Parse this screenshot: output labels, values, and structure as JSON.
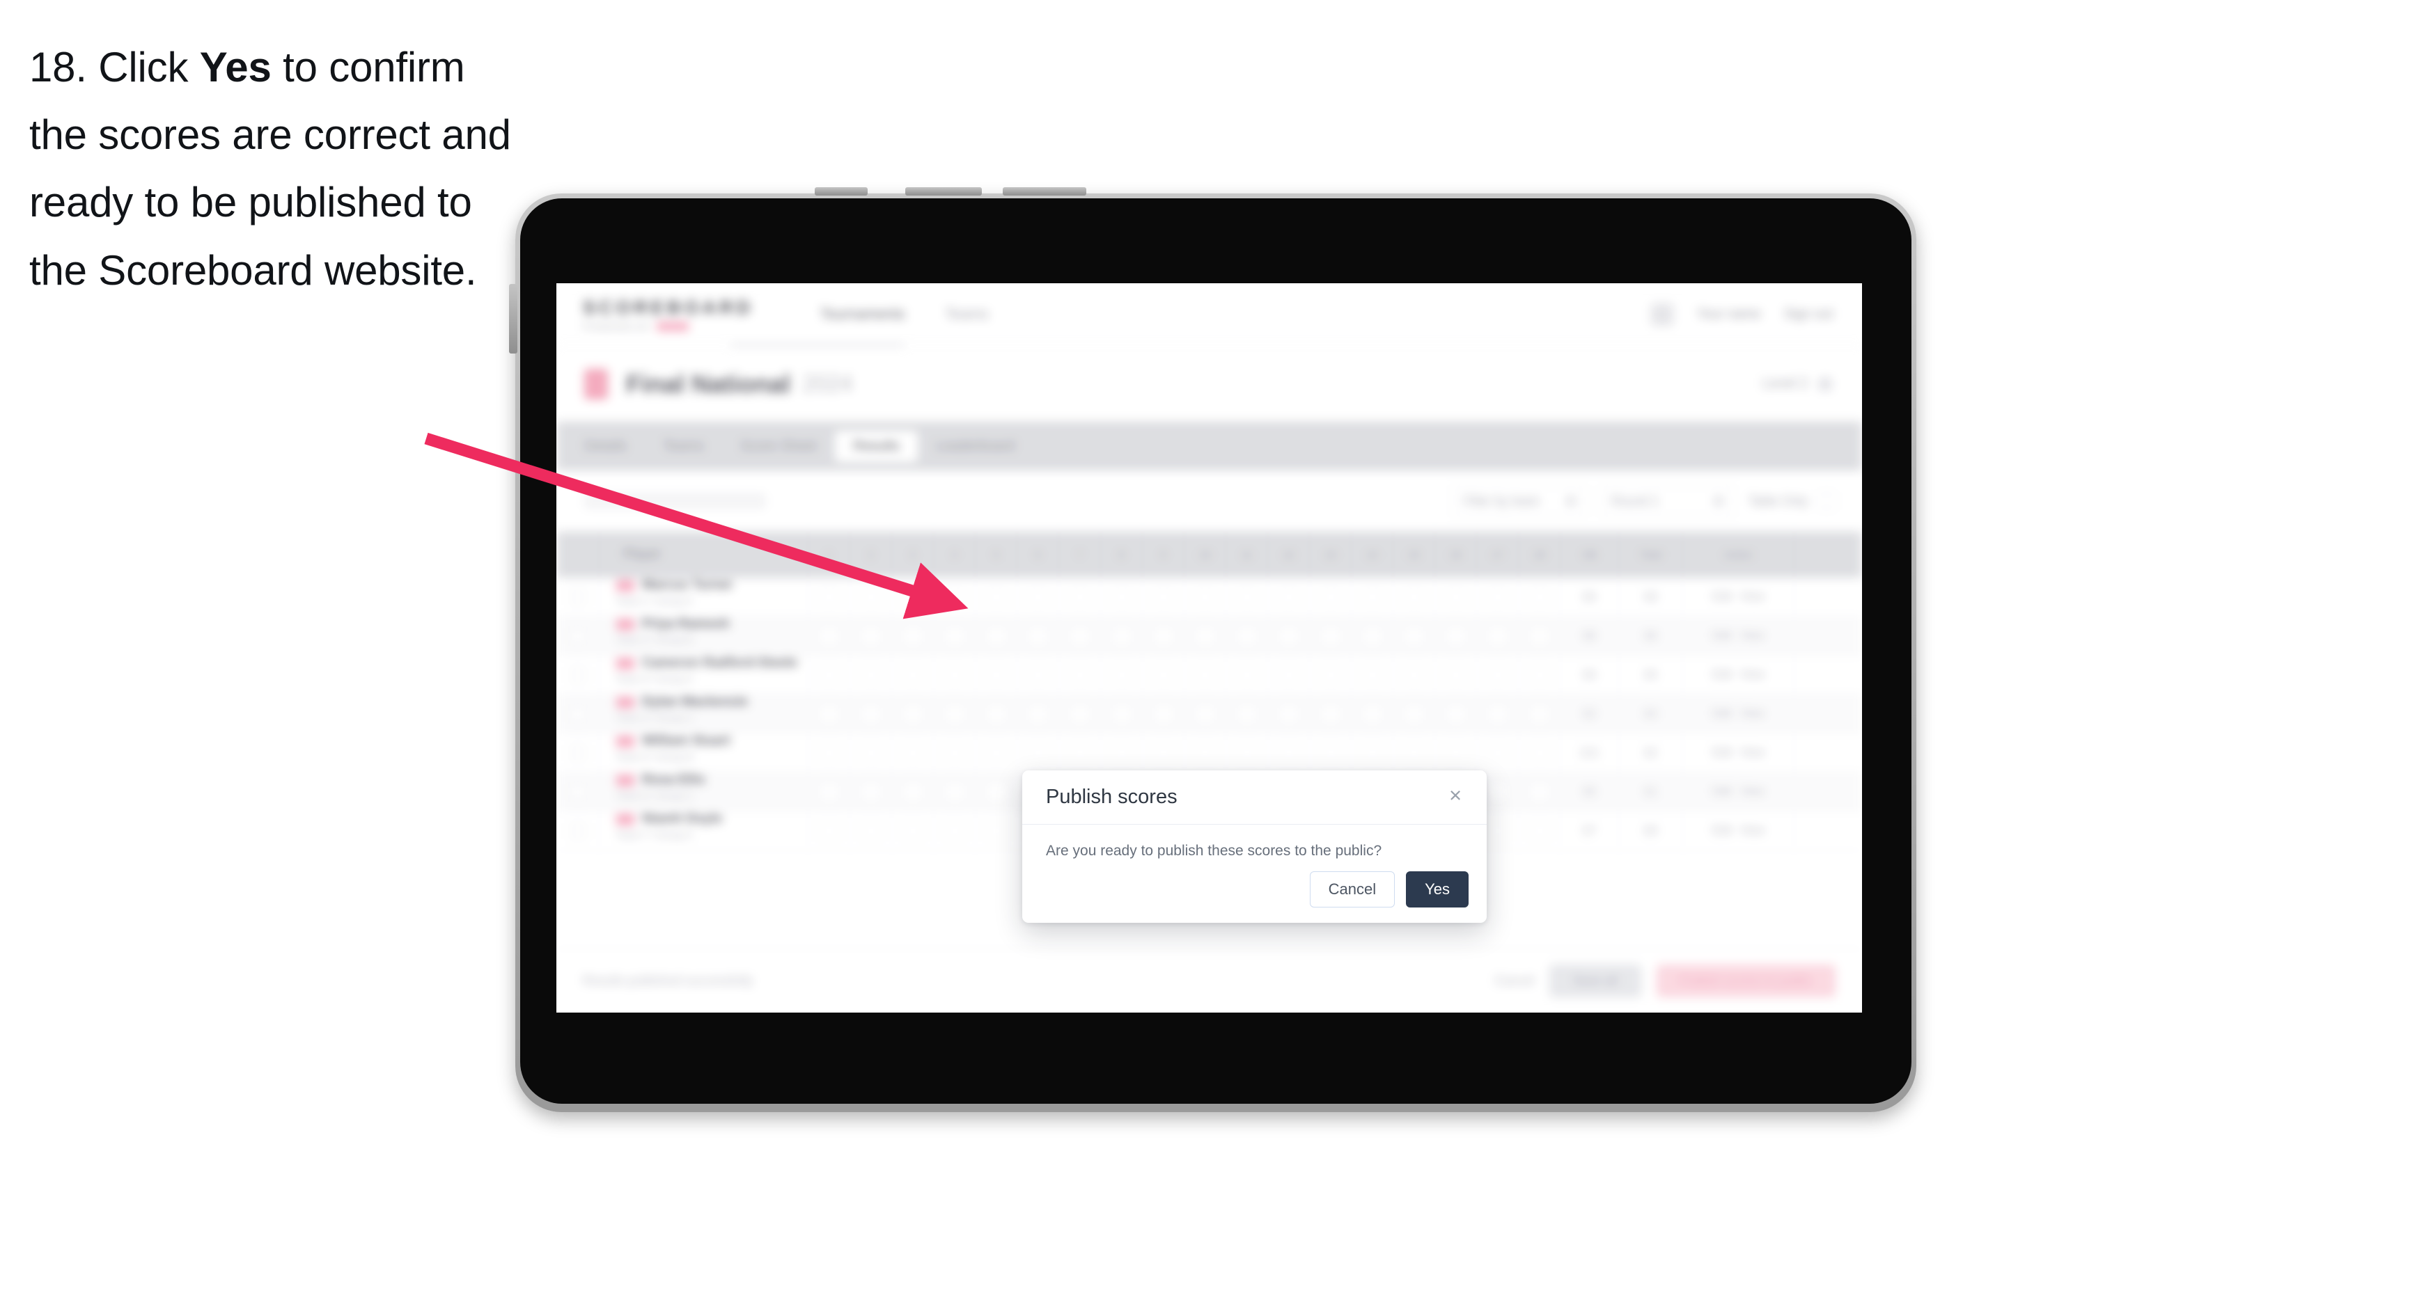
{
  "caption": {
    "number": "18.",
    "pre": "Click",
    "bold": "Yes",
    "post": "to confirm the scores are correct and ready to be published to the Scoreboard website."
  },
  "colors": {
    "arrow": "#ee2b5e",
    "primary_button": "#2c3a4f",
    "cancel_border": "#cfdcf0",
    "brand_accent": "#f7a8be",
    "tab_bar": "#d7d8dc"
  },
  "modal": {
    "title": "Publish scores",
    "message": "Are you ready to publish these scores to the public?",
    "close_icon": "×",
    "cancel_label": "Cancel",
    "confirm_label": "Yes"
  },
  "app": {
    "brand": {
      "word": "SCOREBOARD",
      "sub": "POWERED BY"
    },
    "top_nav": [
      "Tournaments",
      "Teams"
    ],
    "header_right": [
      "Your name",
      "Sign out"
    ],
    "title_bar": {
      "flag": "flag-icon",
      "competition": "Final National",
      "year": "2024",
      "right_label": "Level 2"
    },
    "tabs": [
      {
        "label": "Details",
        "selected": false
      },
      {
        "label": "Teams",
        "selected": false
      },
      {
        "label": "Score Sheet",
        "selected": false
      },
      {
        "label": "Results",
        "selected": true
      },
      {
        "label": "Leaderboard",
        "selected": false
      }
    ],
    "filters": {
      "search_placeholder": "Search",
      "filter_one": "Filter by team",
      "filter_two": "Round 1",
      "filter_three": "Table Only"
    },
    "table": {
      "columns": [
        "",
        "Player",
        "1",
        "2",
        "3",
        "4",
        "5",
        "6",
        "7",
        "8",
        "9",
        "10",
        "11",
        "12",
        "13",
        "14",
        "15",
        "16",
        "17",
        "18",
        "OB",
        "Total",
        "Action"
      ],
      "rows": [
        {
          "name": "Marcus Turner",
          "sub": "Team 1 / Group A",
          "total": "86",
          "bonus": "98",
          "action_a": "Edit",
          "action_b": "View"
        },
        {
          "name": "Priya Ramesh",
          "sub": "Team 2 / Group B",
          "total": "88",
          "bonus": "96",
          "action_a": "Edit",
          "action_b": "View"
        },
        {
          "name": "Cameron Radford-Steele",
          "sub": "Team 3 / Group A",
          "total": "90",
          "bonus": "95",
          "action_a": "Edit",
          "action_b": "View"
        },
        {
          "name": "Dylan Mackenzie",
          "sub": "Team 4 / Group C",
          "total": "92",
          "bonus": "94",
          "action_a": "Edit",
          "action_b": "View"
        },
        {
          "name": "William Stuart",
          "sub": "Team 5 / Group B",
          "total": "101",
          "bonus": "92",
          "action_a": "Edit",
          "action_b": "View"
        },
        {
          "name": "Rosa Ellis",
          "sub": "Team 6 / Group C",
          "total": "95",
          "bonus": "91",
          "action_a": "Edit",
          "action_b": "View"
        },
        {
          "name": "Niamh Doyle",
          "sub": "Team 7 / Group A",
          "total": "97",
          "bonus": "89",
          "action_a": "Edit",
          "action_b": "View"
        }
      ]
    },
    "footer": {
      "note": "Results published successfully",
      "link": "Cancel",
      "gray_button": "Save all",
      "pink_button": "Publish scores to public"
    }
  }
}
